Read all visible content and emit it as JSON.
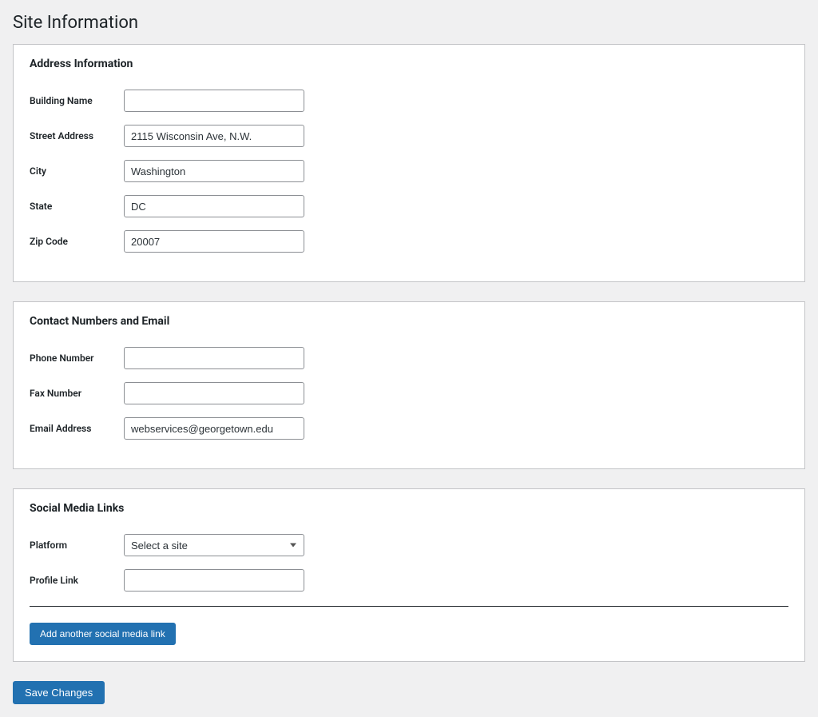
{
  "page": {
    "title": "Site Information"
  },
  "sections": {
    "address": {
      "heading": "Address Information",
      "fields": {
        "building_name": {
          "label": "Building Name",
          "value": ""
        },
        "street_address": {
          "label": "Street Address",
          "value": "2115 Wisconsin Ave, N.W."
        },
        "city": {
          "label": "City",
          "value": "Washington"
        },
        "state": {
          "label": "State",
          "value": "DC"
        },
        "zip": {
          "label": "Zip Code",
          "value": "20007"
        }
      }
    },
    "contact": {
      "heading": "Contact Numbers and Email",
      "fields": {
        "phone": {
          "label": "Phone Number",
          "value": ""
        },
        "fax": {
          "label": "Fax Number",
          "value": ""
        },
        "email": {
          "label": "Email Address",
          "value": "webservices@georgetown.edu"
        }
      }
    },
    "social": {
      "heading": "Social Media Links",
      "fields": {
        "platform": {
          "label": "Platform",
          "selected": "Select a site"
        },
        "profile_link": {
          "label": "Profile Link",
          "value": ""
        }
      },
      "add_button": "Add another social media link"
    }
  },
  "actions": {
    "save": "Save Changes"
  }
}
